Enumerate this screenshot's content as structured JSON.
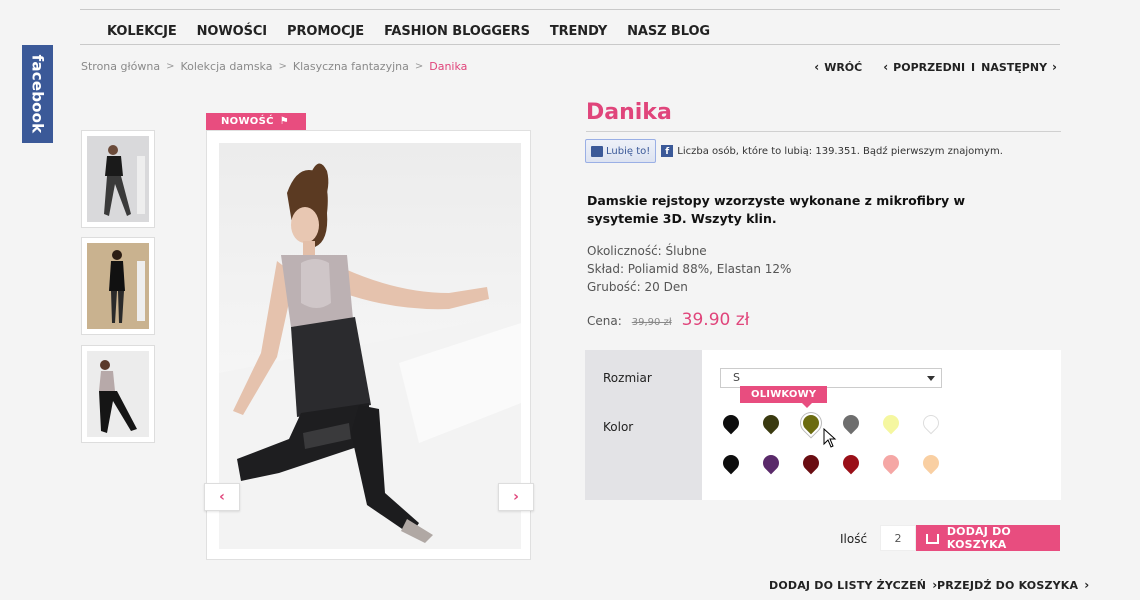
{
  "facebook_tab": "facebook",
  "nav": [
    "KOLEKCJE",
    "NOWOŚCI",
    "PROMOCJE",
    "FASHION BLOGGERS",
    "TRENDY",
    "NASZ BLOG"
  ],
  "breadcrumb": [
    "Strona główna",
    "Kolekcja damska",
    "Klasyczna fantazyjna",
    "Danika"
  ],
  "pager": {
    "back": "WRÓĆ",
    "prev": "POPRZEDNI",
    "divider": "I",
    "next": "NASTĘPNY"
  },
  "badge_new": "NOWOŚĆ",
  "product": {
    "title": "Danika",
    "like_button": "Lubię to!",
    "like_text": "Liczba osób, które to lubią: 139.351. Bądź pierwszym znajomym.",
    "description": "Damskie rejstopy wzorzyste wykonane z mikrofibry w sysytemie 3D. Wszyty klin.",
    "attributes": [
      "Okoliczność: Ślubne",
      "Skład: Poliamid 88%, Elastan 12%",
      "Grubość: 20 Den"
    ],
    "price_label": "Cena:",
    "price_old": "39,90 zł",
    "price_new": "39.90 zł"
  },
  "options": {
    "size_label": "Rozmiar",
    "size_value": "S",
    "color_label": "Kolor",
    "tooltip": "OLIWKOWY",
    "colors_row1": [
      "#0d0d0d",
      "#3a3a10",
      "#6b6b10",
      "#6e6e6e",
      "#f5f7a0",
      "#ffffff"
    ],
    "colors_row2": [
      "#0d0d0d",
      "#5a2a6a",
      "#6a0d12",
      "#9a0f18",
      "#f5a7a5",
      "#f9cfa2"
    ]
  },
  "cart": {
    "qty_label": "Ilość",
    "qty_value": "2",
    "add_button": "DODAJ DO KOSZYKA"
  },
  "bottom_links": {
    "wishlist": "DODAJ DO LISTY ŻYCZEŃ",
    "go_to_cart": "PRZEJDŹ DO KOSZYKA"
  }
}
